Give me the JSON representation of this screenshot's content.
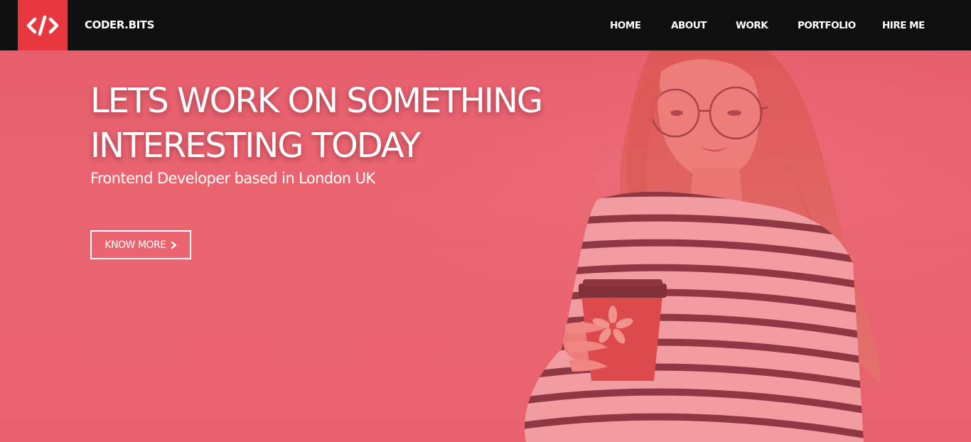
{
  "navbar": {
    "brand": "CODER.BITS",
    "logo_icon": "code-brackets-icon",
    "items": [
      {
        "label": "HOME"
      },
      {
        "label": "ABOUT"
      },
      {
        "label": "WORK"
      },
      {
        "label": "PORTFOLIO"
      },
      {
        "label": "HIRE ME"
      }
    ]
  },
  "hero": {
    "title_line1": "LETS WORK ON SOMETHING",
    "title_line2": "INTERESTING TODAY",
    "subtitle": "Frontend Developer based in London UK",
    "cta_label": "KNOW MORE",
    "cta_icon": "chevron-right-icon"
  },
  "colors": {
    "accent": "#e8373f",
    "navbar_bg": "#0f0f10",
    "overlay": "#e9626f"
  }
}
